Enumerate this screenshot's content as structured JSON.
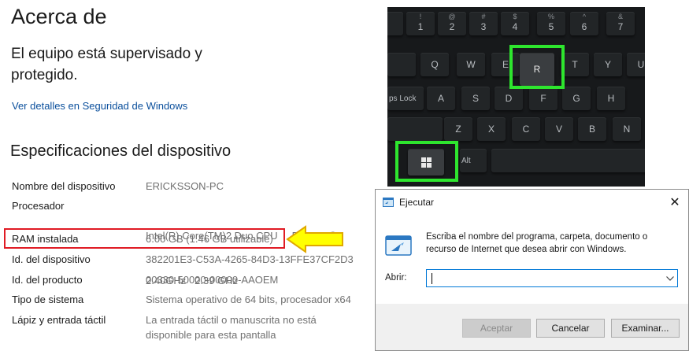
{
  "about": {
    "title": "Acerca de",
    "status_line1": "El equipo está supervisado y",
    "status_line2": "protegido.",
    "security_link": "Ver detalles en Seguridad de Windows",
    "specs_title": "Especificaciones del dispositivo",
    "specs": [
      {
        "label": "Nombre del dispositivo",
        "value": "ERICKSSON-PC"
      },
      {
        "label": "Procesador",
        "value": "Intel(R) Core(TM)2 Duo CPU     P8600  @",
        "value2": "2.40GHz   2.39 GHz"
      },
      {
        "label": "RAM instalada",
        "value": "6.00 GB (1.46 GB utilizable)"
      },
      {
        "label": "Id. del dispositivo",
        "value": "382201E3-C53A-4265-84D3-13FFE37CF2D3"
      },
      {
        "label": "Id. del producto",
        "value": "00330-50000-00000-AAOEM"
      },
      {
        "label": "Tipo de sistema",
        "value": "Sistema operativo de 64 bits, procesador x64"
      },
      {
        "label": "Lápiz y entrada táctil",
        "value": "La entrada táctil o manuscrita no está",
        "value2": "disponible para esta pantalla"
      }
    ]
  },
  "keyboard": {
    "row1": [
      {
        "top": "!",
        "main": "1"
      },
      {
        "top": "@",
        "main": "2"
      },
      {
        "top": "#",
        "main": "3"
      },
      {
        "top": "$",
        "main": "4"
      },
      {
        "top": "%",
        "main": "5"
      },
      {
        "top": "^",
        "main": "6"
      },
      {
        "top": "&",
        "main": "7"
      }
    ],
    "row2": [
      "Q",
      "W",
      "E",
      "R",
      "T",
      "Y",
      "U"
    ],
    "row3_caps": "ps Lock",
    "row3": [
      "A",
      "S",
      "D",
      "F",
      "G",
      "H"
    ],
    "row4": [
      "Z",
      "X",
      "C",
      "V",
      "B",
      "N"
    ],
    "alt": "Alt"
  },
  "dialog": {
    "title": "Ejecutar",
    "close": "✕",
    "description": "Escriba el nombre del programa, carpeta, documento o recurso de Internet que desea abrir con Windows.",
    "open_label": "Abrir:",
    "open_value": "",
    "buttons": {
      "ok": "Aceptar",
      "cancel": "Cancelar",
      "browse": "Examinar..."
    }
  },
  "colors": {
    "highlight_red": "#e01b24",
    "highlight_green": "#2ee62e",
    "arrow_yellow": "#ffff00",
    "link": "#0a4f9c"
  }
}
